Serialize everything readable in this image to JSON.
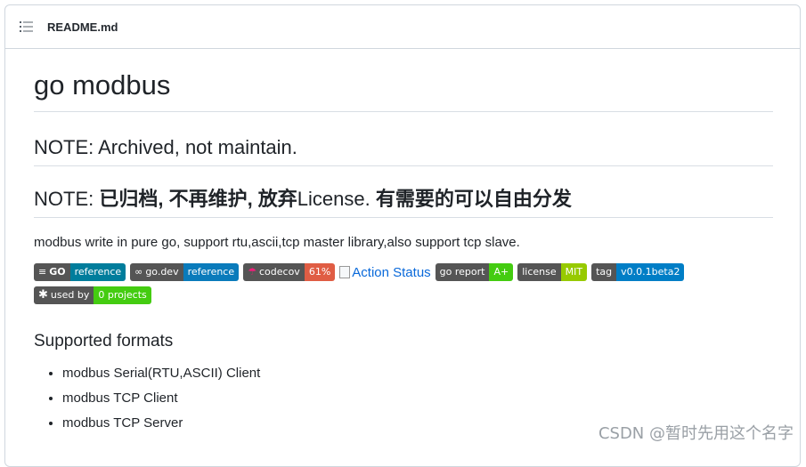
{
  "header": {
    "file_name": "README.md"
  },
  "readme": {
    "title": "go modbus",
    "note1": "NOTE: Archived, not maintain.",
    "note2_prefix": "NOTE: ",
    "note2_zh": "已归档, 不再维护, 放弃",
    "note2_mid": "License. ",
    "note2_zh2": "有需要的可以自由分发",
    "description": "modbus write in pure go, support rtu,ascii,tcp master library,also support tcp slave.",
    "badges": [
      {
        "left": "GO",
        "right": "reference"
      },
      {
        "left": "go.dev",
        "right": "reference"
      },
      {
        "left": "codecov",
        "right": "61%"
      },
      {
        "left": "go report",
        "right": "A+"
      },
      {
        "left": "license",
        "right": "MIT"
      },
      {
        "left": "tag",
        "right": "v0.0.1beta2"
      },
      {
        "left": "used by",
        "right": "0 projects"
      }
    ],
    "action_status_alt": "Action Status",
    "formats_heading": "Supported formats",
    "formats": [
      "modbus Serial(RTU,ASCII) Client",
      "modbus TCP Client",
      "modbus TCP Server"
    ]
  },
  "watermark": "CSDN @暂时先用这个名字",
  "colors": {
    "link": "#0969da",
    "badge_left": "#555555",
    "codecov_red": "#e05d44",
    "go_report_green": "#44cc11"
  }
}
